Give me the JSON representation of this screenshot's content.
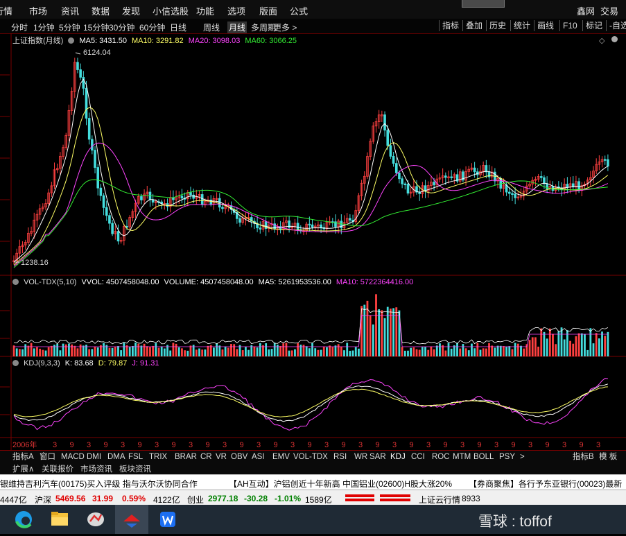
{
  "menu": {
    "items": [
      "行情",
      "市场",
      "资讯",
      "数据",
      "发现",
      "小信选股",
      "功能",
      "选项",
      "版面",
      "公式"
    ],
    "right": [
      "鑫网",
      "交易"
    ]
  },
  "periods": {
    "items": [
      "分时",
      "1分钟",
      "5分钟",
      "15分钟",
      "30分钟",
      "60分钟",
      "日线",
      "周线",
      "月线",
      "多周期",
      "更多 >"
    ],
    "active": "月线"
  },
  "right_buttons": [
    "指标",
    "叠加",
    "历史",
    "统计",
    "画线",
    "F10",
    "标记",
    "-自选"
  ],
  "price_panel": {
    "title": "上证指数(月线)",
    "ma5": "MA5: 3431.50",
    "ma10": "MA10: 3291.82",
    "ma20": "MA20: 3098.03",
    "ma60": "MA60: 3066.25",
    "high_label": "6124.04",
    "low_label": "1238.16",
    "colors": {
      "ma5": "#ffffff",
      "ma10": "#ffff66",
      "ma20": "#ff44ff",
      "ma60": "#33ee33",
      "up": "#ff4040",
      "down": "#44dddd"
    }
  },
  "volume_panel": {
    "title": "VOL-TDX(5,10)",
    "vvol": "VVOL: 4507458048.00",
    "volume": "VOLUME: 4507458048.00",
    "ma5": "MA5: 5261953536.00",
    "ma10": "MA10: 5722364416.00"
  },
  "kdj_panel": {
    "title": "KDJ(9,3,3)",
    "k": "K: 83.68",
    "d": "D: 79.87",
    "j": "J: 91.31"
  },
  "x_axis": {
    "start_label": "2006年",
    "tick_labels": [
      "3",
      "9",
      "3",
      "9",
      "3",
      "9",
      "3",
      "9",
      "3",
      "9",
      "3",
      "9",
      "3",
      "9",
      "3",
      "9",
      "3",
      "9",
      "3",
      "9",
      "3",
      "9",
      "3",
      "9",
      "3",
      "9",
      "3",
      "9",
      "3",
      "9",
      "3",
      "9",
      "3",
      "9",
      "3",
      "9",
      "3",
      "9"
    ]
  },
  "indicator_tabs": [
    "指标A",
    "窗口",
    "MACD",
    "DMI",
    "DMA",
    "FSL",
    "TRIX",
    "BRAR",
    "CR",
    "VR",
    "OBV",
    "ASI",
    "EMV",
    "VOL-TDX",
    "RSI",
    "WR",
    "SAR",
    "KDJ",
    "CCI",
    "ROC",
    "MTM",
    "BOLL",
    "PSY",
    ">"
  ],
  "indicator_tabs_right": [
    "指标B",
    "模 板"
  ],
  "sub_tabs": [
    "扩展∧",
    "关联报价",
    "市场资讯",
    "板块资讯"
  ],
  "news": [
    "银维持吉利汽车(00175)买入评级  指与沃尔沃协同合作",
    "【AH互动】沪铝创近十年新高  中国铝业(02600)H股大涨20%",
    "【券商聚焦】各行予东亚银行(00023)最新"
  ],
  "status": {
    "left_amount": "4447亿",
    "shenzhen_label": "沪深",
    "shenzhen_value": "5469.56",
    "shenzhen_change": "31.99",
    "shenzhen_pct": "0.59%",
    "shenzhen_amount": "4122亿",
    "chuangye_label": "创业",
    "chuangye_value": "2977.18",
    "chuangye_change": "-30.28",
    "chuangye_pct": "-1.01%",
    "chuangye_amount": "1589亿",
    "cloud_label": "上证云行情",
    "cloud_code": "8933"
  },
  "watermark": "雪球 : toffof",
  "taskbar_icons": [
    "edge-browser-icon",
    "file-explorer-icon",
    "trading-app-icon",
    "hexin-app-icon",
    "wps-office-icon"
  ]
}
